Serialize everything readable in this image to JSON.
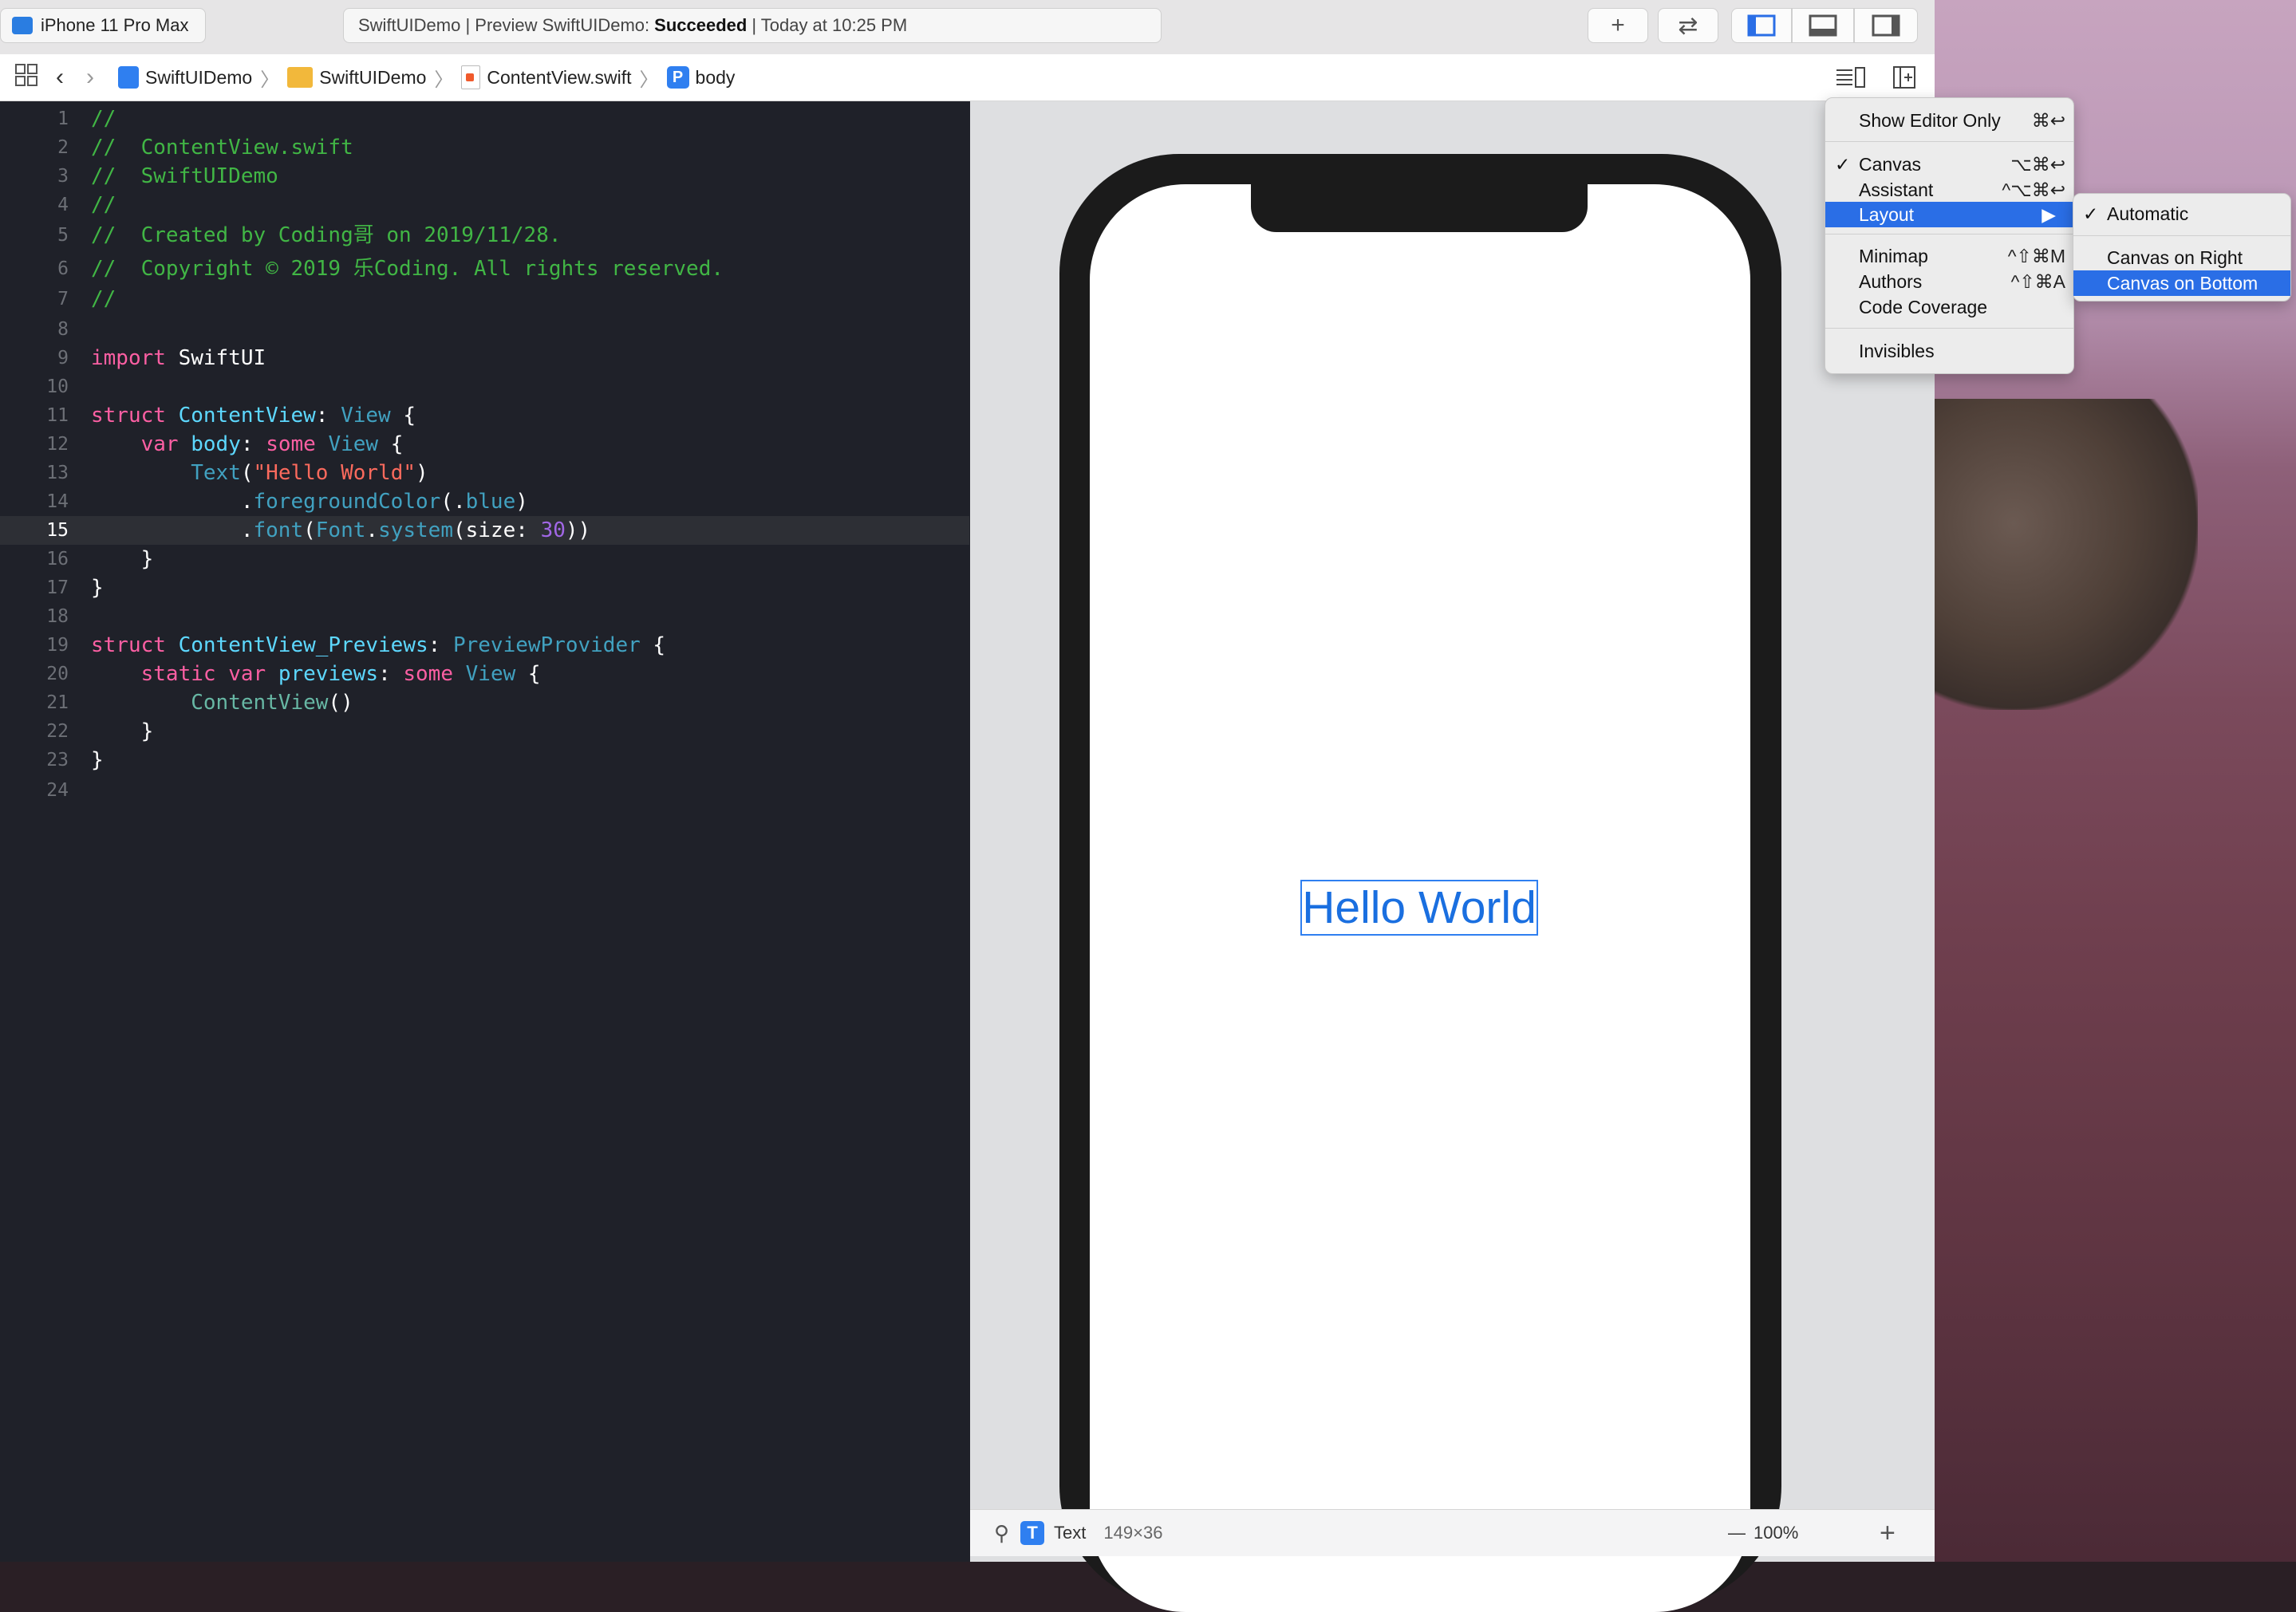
{
  "toolbar": {
    "scheme_device": "iPhone 11 Pro Max",
    "status_prefix": "SwiftUIDemo | Preview SwiftUIDemo:",
    "status_result": "Succeeded",
    "status_time": "| Today at 10:25 PM",
    "add_label": "+",
    "swap_label": "⇄"
  },
  "jumpbar": {
    "items": [
      "SwiftUIDemo",
      "SwiftUIDemo",
      "ContentView.swift",
      "body"
    ]
  },
  "editor": {
    "current_line": 15,
    "line_numbers": [
      "1",
      "2",
      "3",
      "4",
      "5",
      "6",
      "7",
      "8",
      "9",
      "10",
      "11",
      "12",
      "13",
      "14",
      "15",
      "16",
      "17",
      "18",
      "19",
      "20",
      "21",
      "22",
      "23",
      "24"
    ],
    "lines": {
      "l1": "//",
      "l2": "//  ContentView.swift",
      "l3": "//  SwiftUIDemo",
      "l4": "//",
      "l5": "//  Created by Coding哥 on 2019/11/28.",
      "l6": "//  Copyright © 2019 乐Coding. All rights reserved.",
      "l7": "//",
      "l9_kw": "import",
      "l9_rest": " SwiftUI",
      "l11_kw": "struct",
      "l11_name": "ContentView",
      "l11_colon": ": ",
      "l11_type": "View",
      "l11_end": " {",
      "l12_kw": "var",
      "l12_name": "body",
      "l12_colon": ": ",
      "l12_kw2": "some",
      "l12_type": "View",
      "l12_end": " {",
      "l13_fn": "Text",
      "l13_open": "(",
      "l13_str": "\"Hello World\"",
      "l13_close": ")",
      "l14_dot": ".",
      "l14_fn": "foregroundColor",
      "l14_open": "(.",
      "l14_val": "blue",
      "l14_close": ")",
      "l15_dot": ".",
      "l15_fn": "font",
      "l15_open": "(",
      "l15_type": "Font",
      "l15_dot2": ".",
      "l15_fn2": "system",
      "l15_args": "(size: ",
      "l15_num": "30",
      "l15_close": "))",
      "l16": "}",
      "l17": "}",
      "l19_kw": "struct",
      "l19_name": "ContentView_Previews",
      "l19_colon": ": ",
      "l19_type": "PreviewProvider",
      "l19_end": " {",
      "l20_kw": "static",
      "l20_kw2": "var",
      "l20_name": "previews",
      "l20_colon": ": ",
      "l20_kw3": "some",
      "l20_type": "View",
      "l20_end": " {",
      "l21_fn": "ContentView",
      "l21_end": "()",
      "l22": "}",
      "l23": "}"
    }
  },
  "preview": {
    "text": "Hello World",
    "text_color": "#1a6fe0"
  },
  "canvas_bar": {
    "element_kind_badge": "T",
    "element_kind": "Text",
    "element_size": "149×36",
    "zoom": "100%"
  },
  "editor_menu": {
    "items": [
      {
        "label": "Show Editor Only",
        "shortcut": "⌘↩",
        "checked": false
      },
      {
        "label": "Canvas",
        "shortcut": "⌥⌘↩",
        "checked": true
      },
      {
        "label": "Assistant",
        "shortcut": "^⌥⌘↩",
        "checked": false
      },
      {
        "label": "Layout",
        "shortcut": "▶",
        "checked": false,
        "highlighted": true
      },
      {
        "label": "Minimap",
        "shortcut": "^⇧⌘M",
        "checked": false
      },
      {
        "label": "Authors",
        "shortcut": "^⇧⌘A",
        "checked": false
      },
      {
        "label": "Code Coverage",
        "shortcut": "",
        "checked": false
      },
      {
        "label": "Invisibles",
        "shortcut": "",
        "checked": false
      }
    ],
    "check_mark": "✓"
  },
  "layout_submenu": {
    "items": [
      {
        "label": "Automatic",
        "checked": true
      },
      {
        "label": "Canvas on Right",
        "checked": false
      },
      {
        "label": "Canvas on Bottom",
        "checked": false,
        "highlighted": true
      }
    ],
    "check_mark": "✓"
  },
  "colors": {
    "editor_bg": "#1f2129",
    "comment": "#41b645",
    "keyword": "#fc5fa3",
    "type_decl": "#5dd8ff",
    "type_ref": "#41a1c0",
    "string": "#fc6a5d",
    "number": "#a167e6",
    "menu_highlight": "#2a6ee6"
  }
}
